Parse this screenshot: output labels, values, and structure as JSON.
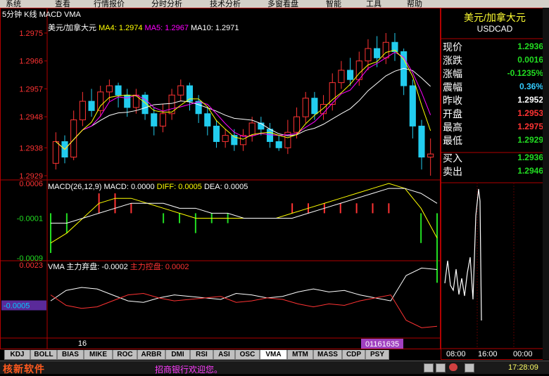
{
  "menu": {
    "items": [
      "系统",
      "查看",
      "行情报价",
      "分时分析",
      "技术分析",
      "多窗看盘",
      "智能",
      "工具",
      "帮助"
    ]
  },
  "chart_header": {
    "title": "5分钟 K线 MACD VMA",
    "series_name": "美元/加拿大元",
    "ma4_label": "MA4: 1.2974",
    "ma5_label": "MA5: 1.2967",
    "ma10_label": "MA10: 1.2971"
  },
  "price_axis": {
    "ticks": [
      "1.2975",
      "1.2966",
      "1.2957",
      "1.2948",
      "1.2938",
      "1.2929"
    ]
  },
  "macd": {
    "header": "MACD(26,12,9)",
    "macd_label": "MACD: 0.0000",
    "diff_label": "DIFF: 0.0005",
    "dea_label": "DEA: 0.0005",
    "ticks": [
      "0.0006",
      "-0.0001",
      "-0.0009"
    ]
  },
  "vma": {
    "header": "VMA",
    "sell_label": "主力弃盘: -0.0002",
    "buy_label": "主力控盘: 0.0002",
    "ticks": [
      "0.0023",
      "-0.0005"
    ]
  },
  "x_axis": {
    "tick_label": "16",
    "cursor_label": "01161635"
  },
  "tabs": [
    "KDJ",
    "BOLL",
    "BIAS",
    "MIKE",
    "ROC",
    "ARBR",
    "DMI",
    "RSI",
    "ASI",
    "OSC",
    "VMA",
    "MTM",
    "MASS",
    "CDP",
    "PSY"
  ],
  "active_tab": "VMA",
  "quote": {
    "title": "美元/加拿大元",
    "symbol": "USDCAD",
    "rows": [
      {
        "label": "现价",
        "value": "1.2936",
        "color": "#22dd22"
      },
      {
        "label": "涨跌",
        "value": "0.0016",
        "color": "#22dd22"
      },
      {
        "label": "涨幅",
        "value": "-0.1235%",
        "color": "#22dd22"
      },
      {
        "label": "震幅",
        "value": "0.36%",
        "color": "#33ccff"
      },
      {
        "label": "昨收",
        "value": "1.2952",
        "color": "#ffffff"
      },
      {
        "label": "开盘",
        "value": "1.2953",
        "color": "#ff3333"
      },
      {
        "label": "最高",
        "value": "1.2975",
        "color": "#ff3333"
      },
      {
        "label": "最低",
        "value": "1.2929",
        "color": "#22dd22"
      },
      {
        "label": "买入",
        "value": "1.2936",
        "color": "#22dd22"
      },
      {
        "label": "卖出",
        "value": "1.2946",
        "color": "#22dd22"
      }
    ],
    "time_ticks": [
      "08:00",
      "16:00",
      "00:00"
    ]
  },
  "status_bar": {
    "logo": "核新软件",
    "message": "招商银行欢迎您。",
    "clock": "17:28:09"
  },
  "colors": {
    "up": "#ff3333",
    "down": "#22ccee",
    "ma4": "#ffff00",
    "ma5": "#ff00ff",
    "ma10": "#ffffff",
    "frame": "#b00000"
  },
  "chart_data": [
    {
      "type": "candlestick",
      "ylim": [
        1.2929,
        1.2975
      ],
      "candles": [
        [
          1.2933,
          1.294,
          1.2943,
          1.2931
        ],
        [
          1.294,
          1.2935,
          1.2942,
          1.2933
        ],
        [
          1.2935,
          1.2947,
          1.295,
          1.2934
        ],
        [
          1.2947,
          1.2953,
          1.2956,
          1.2945
        ],
        [
          1.2953,
          1.295,
          1.2957,
          1.2948
        ],
        [
          1.295,
          1.2956,
          1.2958,
          1.2948
        ],
        [
          1.2956,
          1.2958,
          1.296,
          1.2953
        ],
        [
          1.2958,
          1.2955,
          1.2959,
          1.2951
        ],
        [
          1.2955,
          1.2951,
          1.2957,
          1.2948
        ],
        [
          1.2951,
          1.2955,
          1.2957,
          1.2949
        ],
        [
          1.2955,
          1.2949,
          1.2956,
          1.2947
        ],
        [
          1.2949,
          1.2945,
          1.2951,
          1.2942
        ],
        [
          1.2945,
          1.2949,
          1.2952,
          1.2943
        ],
        [
          1.2949,
          1.2955,
          1.2957,
          1.2947
        ],
        [
          1.2955,
          1.2958,
          1.296,
          1.2953
        ],
        [
          1.2958,
          1.2953,
          1.2959,
          1.295
        ],
        [
          1.2953,
          1.2949,
          1.2955,
          1.2946
        ],
        [
          1.2949,
          1.2945,
          1.2951,
          1.2942
        ],
        [
          1.2945,
          1.294,
          1.2947,
          1.2938
        ],
        [
          1.294,
          1.2942,
          1.2944,
          1.2938
        ],
        [
          1.2942,
          1.2939,
          1.2944,
          1.2937
        ],
        [
          1.2939,
          1.2942,
          1.2944,
          1.2937
        ],
        [
          1.2942,
          1.2946,
          1.2948,
          1.294
        ],
        [
          1.2946,
          1.2944,
          1.2948,
          1.2942
        ],
        [
          1.2944,
          1.294,
          1.2946,
          1.2938
        ],
        [
          1.294,
          1.2938,
          1.2942,
          1.2937
        ],
        [
          1.2938,
          1.2943,
          1.2947,
          1.2936
        ],
        [
          1.2943,
          1.2948,
          1.2951,
          1.2941
        ],
        [
          1.2948,
          1.2954,
          1.2956,
          1.2946
        ],
        [
          1.2954,
          1.2949,
          1.2956,
          1.2947
        ],
        [
          1.2949,
          1.2952,
          1.2955,
          1.2947
        ],
        [
          1.2952,
          1.2959,
          1.2962,
          1.295
        ],
        [
          1.2959,
          1.2963,
          1.2966,
          1.2957
        ],
        [
          1.2963,
          1.296,
          1.2967,
          1.2958
        ],
        [
          1.296,
          1.2966,
          1.2969,
          1.2958
        ],
        [
          1.2966,
          1.297,
          1.2973,
          1.2963
        ],
        [
          1.297,
          1.2967,
          1.2974,
          1.2964
        ],
        [
          1.2967,
          1.2972,
          1.2975,
          1.2965
        ],
        [
          1.2972,
          1.2969,
          1.2975,
          1.2966
        ],
        [
          1.2969,
          1.2958,
          1.297,
          1.2955
        ],
        [
          1.2958,
          1.2945,
          1.296,
          1.2941
        ],
        [
          1.2945,
          1.2935,
          1.2947,
          1.2931
        ],
        [
          1.2935,
          1.2936,
          1.2941,
          1.2929
        ]
      ]
    },
    {
      "type": "line",
      "title": "MACD(26,12,9)",
      "series": [
        {
          "name": "DIFF",
          "values": [
            -0.0006,
            -0.0004,
            -0.0001,
            0.0002,
            0.0003,
            0.0003,
            0.0002,
            0.0001,
            0.0,
            -0.0001,
            -0.0001,
            -0.0001,
            -0.0001,
            -0.0001,
            -0.0001,
            0.0,
            0.0001,
            0.0002,
            0.0003,
            0.0004,
            0.0005,
            0.0006,
            0.0005,
            0.0001,
            -0.0005
          ]
        },
        {
          "name": "DEA",
          "values": [
            -0.0002,
            -0.0002,
            -0.0001,
            0.0,
            0.0001,
            0.0002,
            0.0002,
            0.0002,
            0.0001,
            0.0001,
            0.0,
            0.0,
            -0.0001,
            -0.0001,
            -0.0001,
            -0.0001,
            0.0,
            0.0001,
            0.0002,
            0.0003,
            0.0004,
            0.0005,
            0.0005,
            0.0004,
            0.0002
          ]
        }
      ]
    },
    {
      "type": "line",
      "title": "VMA",
      "series": [
        {
          "name": "主力弃盘",
          "values": [
            -0.0002,
            0.0005,
            0.0007,
            0.0006,
            0.0002,
            -0.0002,
            -0.0003,
            0.0,
            0.0002,
            0.0001,
            0.0,
            -0.0001,
            0.0003,
            0.0002,
            0.0,
            0.0001,
            0.0004,
            0.0006,
            0.0004,
            0.0005,
            0.0002,
            0.0,
            -0.0002,
            0.0015,
            0.002,
            0.0019
          ]
        },
        {
          "name": "主力控盘",
          "values": [
            0.0002,
            -0.0005,
            -0.0007,
            -0.0006,
            -0.0002,
            0.0002,
            0.0003,
            0.0,
            -0.0002,
            -0.0001,
            0.0,
            0.0001,
            -0.0003,
            -0.0002,
            0.0,
            -0.0001,
            -0.0004,
            -0.0006,
            -0.0004,
            -0.0005,
            -0.0002,
            0.0,
            0.0002,
            -0.0015,
            -0.002,
            -0.0019
          ]
        }
      ]
    }
  ]
}
